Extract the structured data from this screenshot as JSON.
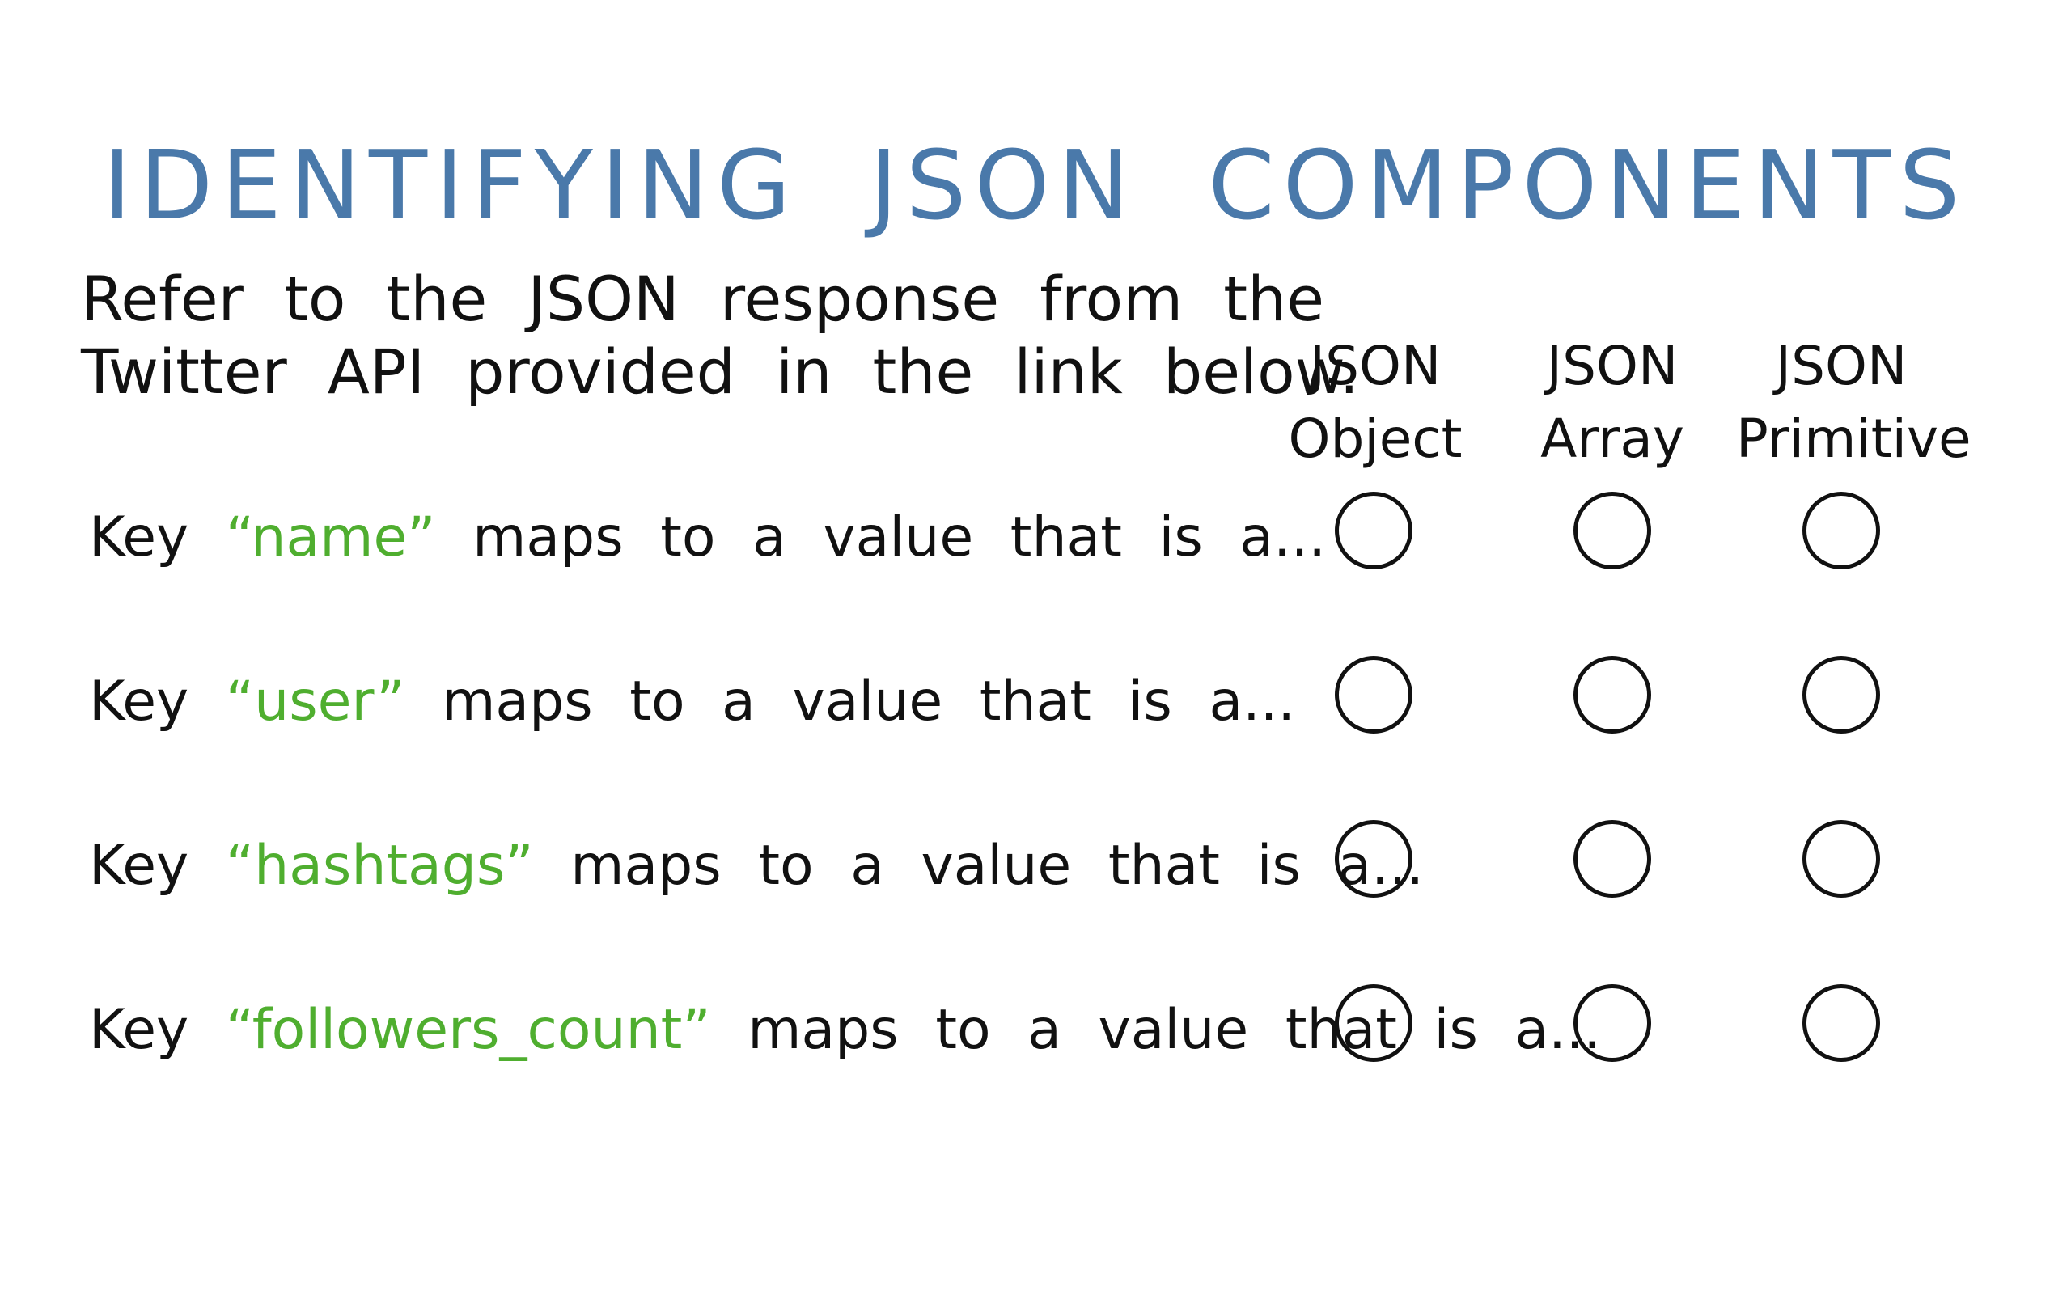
{
  "title": "IDENTIFYING JSON COMPONENTS",
  "intro": {
    "line1": "Refer to the JSON response from the",
    "line2": "Twitter API provided in the link below."
  },
  "columns": [
    {
      "line1": "JSON",
      "line2": "Object"
    },
    {
      "line1": "JSON",
      "line2": "Array"
    },
    {
      "line1": "JSON",
      "line2": "Primitive"
    }
  ],
  "questions": [
    {
      "prefix": "Key",
      "key": "“name”",
      "suffix": "maps to a value that is a..."
    },
    {
      "prefix": "Key",
      "key": "“user”",
      "suffix": "maps to a value that is a..."
    },
    {
      "prefix": "Key",
      "key": "“hashtags”",
      "suffix": "maps to a value that is a..."
    },
    {
      "prefix": "Key",
      "key": "“followers_count”",
      "suffix": "maps to a value that is a..."
    }
  ],
  "colors": {
    "title": "#4a79aa",
    "key": "#4fae2f",
    "text": "#111111"
  }
}
